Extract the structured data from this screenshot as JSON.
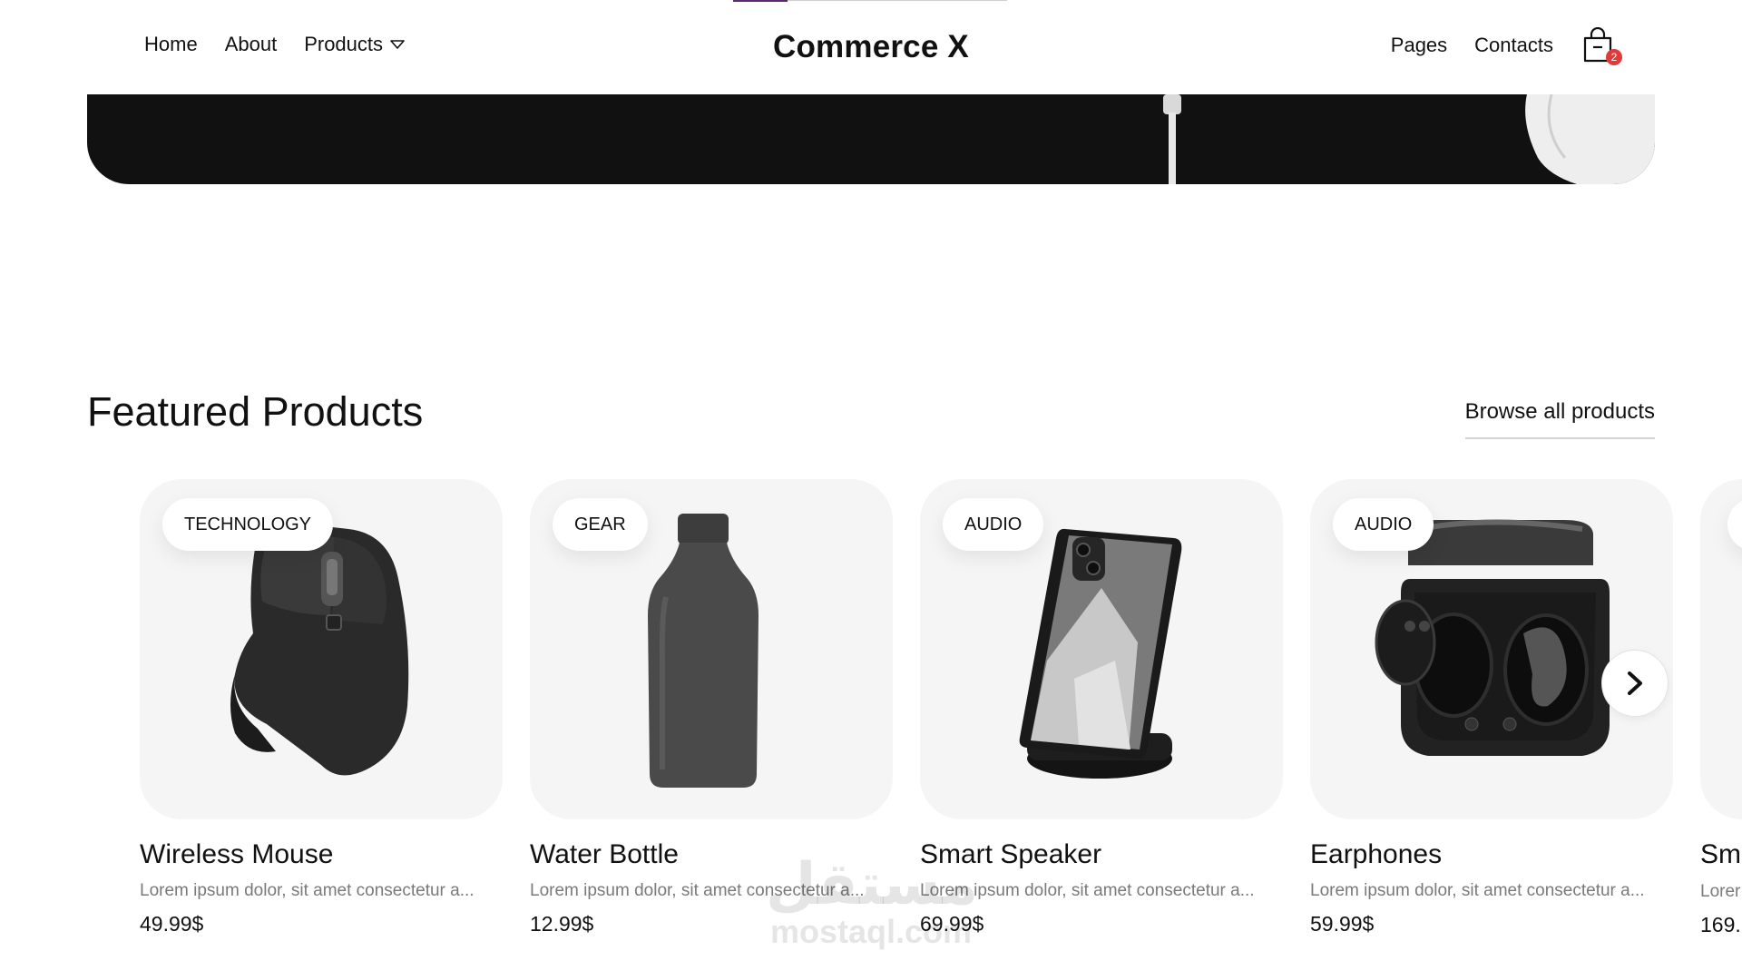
{
  "brand": "Commerce X",
  "nav": {
    "home": "Home",
    "about": "About",
    "products": "Products",
    "pages": "Pages",
    "contacts": "Contacts"
  },
  "cart": {
    "count": "2",
    "icon": "shopping-bag-icon"
  },
  "colors": {
    "badge": "#e03a3a",
    "accent": "#5b2a6e",
    "card_bg": "#f5f5f5"
  },
  "section": {
    "title": "Featured Products",
    "browse_label": "Browse all products"
  },
  "products": [
    {
      "tag": "TECHNOLOGY",
      "name": "Wireless Mouse",
      "desc": "Lorem ipsum dolor, sit amet consectetur a...",
      "price": "49.99$",
      "image": "mouse-image"
    },
    {
      "tag": "GEAR",
      "name": "Water Bottle",
      "desc": "Lorem ipsum dolor, sit amet consectetur a...",
      "price": "12.99$",
      "image": "bottle-image"
    },
    {
      "tag": "AUDIO",
      "name": "Smart Speaker",
      "desc": "Lorem ipsum dolor, sit amet consectetur a...",
      "price": "69.99$",
      "image": "phone-stand-image"
    },
    {
      "tag": "AUDIO",
      "name": "Earphones",
      "desc": "Lorem ipsum dolor, sit amet consectetur a...",
      "price": "59.99$",
      "image": "earbuds-case-image"
    }
  ],
  "partial_product": {
    "name": "Sm",
    "desc": "Lorer",
    "price": "169."
  },
  "watermark": {
    "arabic": "مستقل",
    "latin": "mostaql.com"
  }
}
